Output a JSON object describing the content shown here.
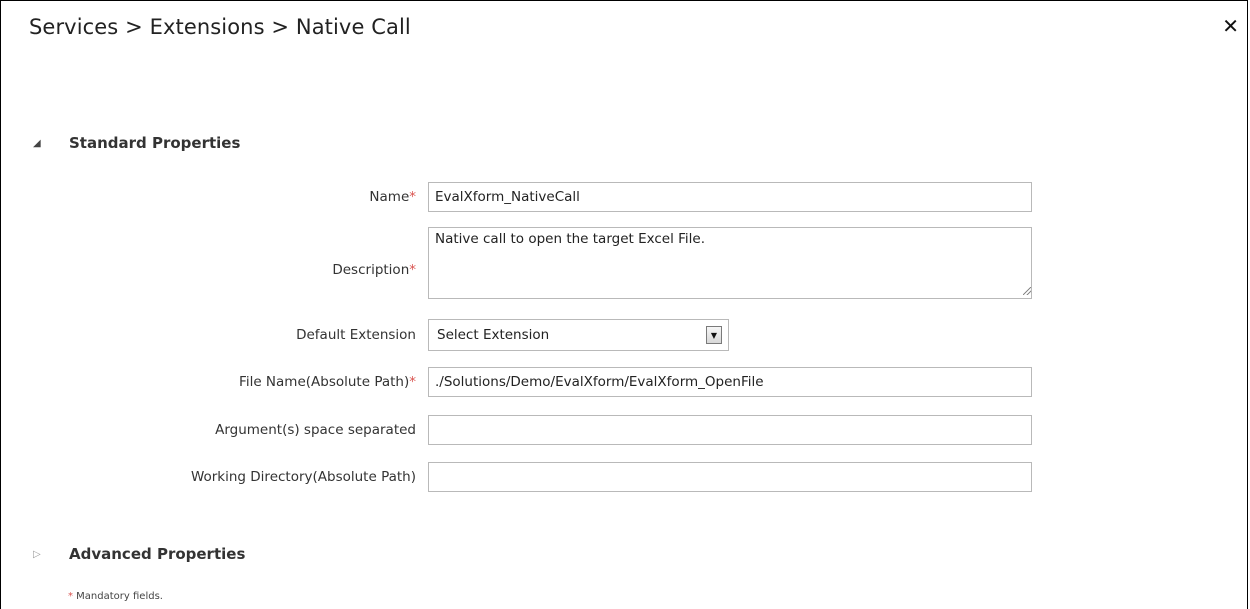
{
  "header": {
    "breadcrumb": "Services > Extensions > Native Call",
    "close_symbol": "✕"
  },
  "sections": {
    "standard": {
      "label": "Standard Properties",
      "expanded": true
    },
    "advanced": {
      "label": "Advanced Properties",
      "expanded": false
    }
  },
  "form": {
    "name": {
      "label": "Name",
      "required_mark": "*",
      "value": "EvalXform_NativeCall"
    },
    "description": {
      "label": "Description",
      "required_mark": "*",
      "value": "Native call to open the target Excel File."
    },
    "default_extension": {
      "label": "Default Extension",
      "selected": "Select Extension"
    },
    "file_name": {
      "label": "File Name(Absolute Path)",
      "required_mark": "*",
      "value": "./Solutions/Demo/EvalXform/EvalXform_OpenFile"
    },
    "arguments": {
      "label": "Argument(s) space separated",
      "value": ""
    },
    "working_directory": {
      "label": "Working Directory(Absolute Path)",
      "value": ""
    }
  },
  "footer": {
    "required_mark": "*",
    "note": " Mandatory fields."
  },
  "colors": {
    "required": "#d9534f",
    "border": "#b9b9b9"
  }
}
